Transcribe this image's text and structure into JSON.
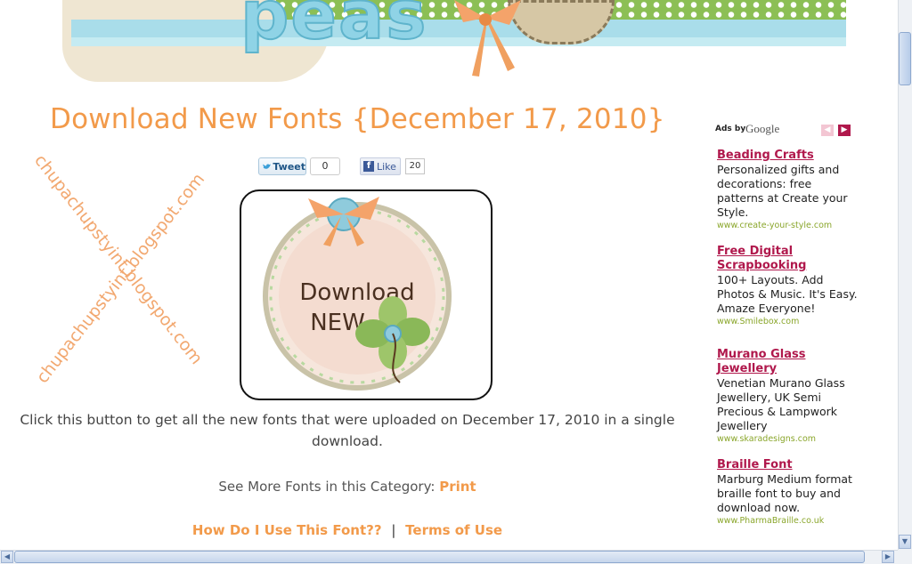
{
  "header": {
    "banner_text": "peas"
  },
  "post": {
    "title": "Download New Fonts {December 17, 2010}",
    "watermark_text": "chupachupstyint.blogspot.com",
    "tweet_label": "Tweet",
    "tweet_count": "0",
    "like_label": "Like",
    "like_count": "20",
    "badge_text_line1": "Download",
    "badge_text_line2": "NEW",
    "body": "Click this button to get all the new fonts that were uploaded on December 17, 2010 in a single download.",
    "more_fonts_label": "See More Fonts in this Category:",
    "more_fonts_category": "Print",
    "how_to_link": "How Do I Use This Font??",
    "separator": "|",
    "terms_link": "Terms of Use"
  },
  "ads": {
    "ads_by": "Ads by",
    "google": "Google",
    "items": [
      {
        "title": "Beading Crafts",
        "desc": "Personalized gifts and decorations: free patterns at Create your Style.",
        "url": "www.create-your-style.com"
      },
      {
        "title": "Free Digital Scrapbooking",
        "desc": "100+ Layouts. Add Photos & Music. It's Easy. Amaze Everyone!",
        "url": "www.Smilebox.com"
      },
      {
        "title": "Murano Glass Jewellery",
        "desc": "Venetian Murano Glass Jewellery, UK Semi Precious & Lampwork Jewellery",
        "url": "www.skaradesigns.com"
      },
      {
        "title": "Braille Font",
        "desc": "Marburg Medium format braille font to buy and download now.",
        "url": "www.PharmaBraille.co.uk"
      }
    ]
  },
  "colors": {
    "title_orange": "#f29a4a",
    "ad_title": "#b0184c",
    "ad_url": "#8aa62b"
  },
  "icons": [
    "twitter-bird-icon",
    "facebook-icon",
    "ad-prev-arrow-icon",
    "ad-next-arrow-icon"
  ]
}
